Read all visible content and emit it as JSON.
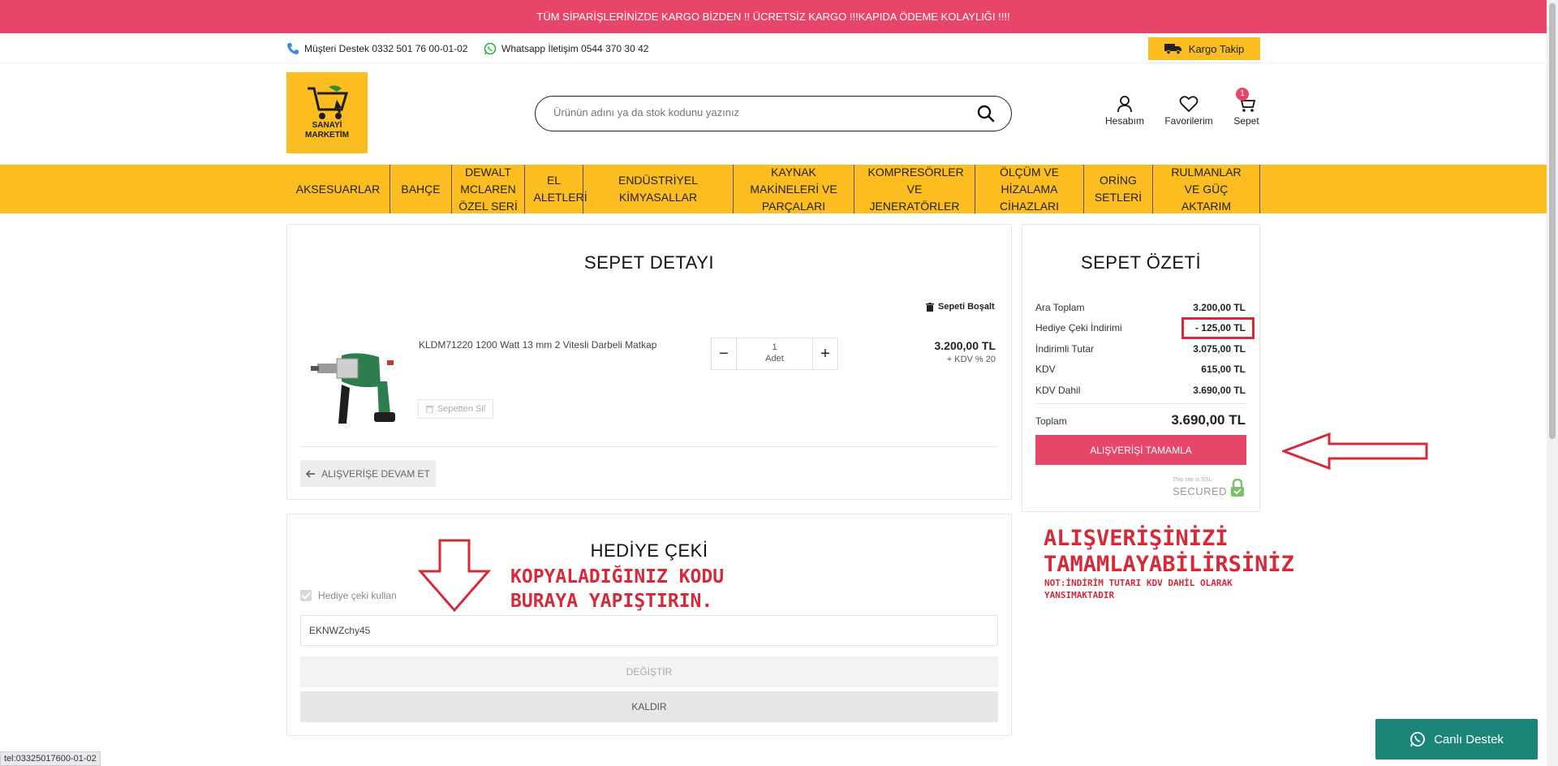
{
  "announcement": "TÜM SİPARİŞLERİNİZDE KARGO BİZDEN !! ÜCRETSİZ KARGO !!!KAPIDA ÖDEME KOLAYLIĞI !!!!",
  "contact": {
    "support": "Müşteri Destek 0332 501 76 00-01-02",
    "whatsapp": "Whatsapp İletişim 0544 370 30 42"
  },
  "cargo_tracking": "Kargo Takip",
  "logo": {
    "line1": "SANAYİ",
    "line2": "MARKETİM"
  },
  "search": {
    "placeholder": "Ürünün adını ya da stok kodunu yazınız"
  },
  "header_links": {
    "account": "Hesabım",
    "favorites": "Favorilerim",
    "cart": "Sepet",
    "cart_count": "1"
  },
  "nav": [
    "AKSESUARLAR",
    "BAHÇE",
    "DEWALT MCLAREN ÖZEL SERİ",
    "EL ALETLERİ",
    "ENDÜSTRİYEL KİMYASALLAR",
    "KAYNAK MAKİNELERİ VE PARÇALARI",
    "KOMPRESÖRLER VE JENERATÖRLER",
    "ÖLÇÜM VE HİZALAMA CİHAZLARI",
    "ORİNG SETLERİ",
    "RULMANLAR VE GÜÇ AKTARIM"
  ],
  "cart": {
    "title": "SEPET DETAYI",
    "clear": "Sepeti Boşalt",
    "item": {
      "name": "KLDM71220 1200 Watt 13 mm 2 Vitesli Darbeli Matkap",
      "qty": "1",
      "qty_unit": "Adet",
      "price": "3.200,00 TL",
      "vat": "+ KDV % 20",
      "remove": "Sepetten Sil"
    },
    "continue": "ALIŞVERİŞE DEVAM ET"
  },
  "summary": {
    "title": "SEPET ÖZETİ",
    "rows": [
      {
        "label": "Ara Toplam",
        "value": "3.200,00 TL"
      },
      {
        "label": "Hediye Çeki İndirimi",
        "value": "- 125,00 TL"
      },
      {
        "label": "İndirimli Tutar",
        "value": "3.075,00 TL"
      },
      {
        "label": "KDV",
        "value": "615,00 TL"
      },
      {
        "label": "KDV Dahil",
        "value": "3.690,00 TL"
      }
    ],
    "total_label": "Toplam",
    "total_value": "3.690,00 TL",
    "checkout": "ALIŞVERİŞİ TAMAMLA",
    "ssl_small": "This site is SSL",
    "ssl_big": "SECURED"
  },
  "gift": {
    "title": "HEDİYE ÇEKİ",
    "use_label": "Hediye çeki kullan",
    "code": "EKNWZchy45",
    "change": "DEĞİŞTİR",
    "remove": "KALDIR"
  },
  "annotations": {
    "paste_line1": "KOPYALADIĞINIZ KODU",
    "paste_line2": "BURAYA YAPIŞTIRIN.",
    "complete_line1": "ALIŞVERİŞİNİZİ",
    "complete_line2": "TAMAMLAYABİLİRSİNİZ",
    "note_line1": "NOT:İNDİRİM TUTARI KDV DAHİL OLARAK",
    "note_line2": "YANSIMAKTADIR"
  },
  "live_support": "Canlı Destek",
  "status_url": "tel:03325017600-01-02",
  "colors": {
    "accent": "#e8456a",
    "brand_yellow": "#fbbd1f",
    "annotation_red": "#d42a3a",
    "whatsapp_green": "#1b8577"
  }
}
